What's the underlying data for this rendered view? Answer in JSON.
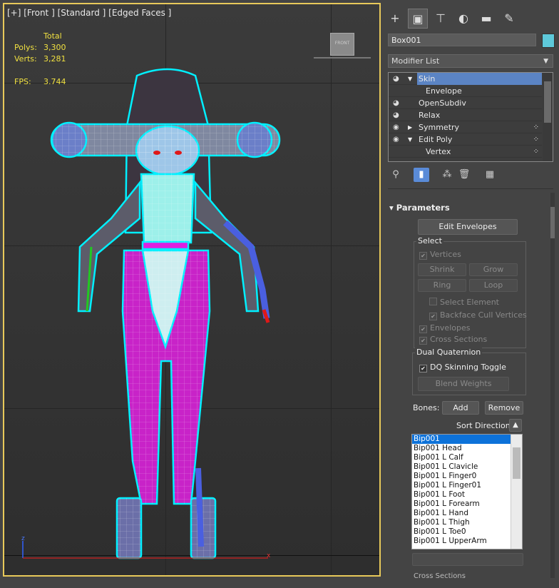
{
  "viewport": {
    "label": "[+] [Front ] [Standard ] [Edged Faces ]",
    "stats": {
      "total_label": "Total",
      "polys_label": "Polys:",
      "polys_value": "3,300",
      "verts_label": "Verts:",
      "verts_value": "3,281",
      "fps_label": "FPS:",
      "fps_value": "3.744"
    },
    "viewcube_label": "FRONT",
    "axis_z": "z",
    "axis_x": "x"
  },
  "command_panel": {
    "tabs": [
      "plus-icon",
      "modify-icon",
      "hierarchy-icon",
      "motion-icon",
      "display-icon",
      "utilities-icon"
    ],
    "object_name": "Box001",
    "object_color": "#5ec9da",
    "modifier_list_label": "Modifier List",
    "stack": [
      {
        "label": "Skin",
        "selected": true
      },
      {
        "label": "Envelope",
        "sub": true
      },
      {
        "label": "OpenSubdiv"
      },
      {
        "label": "Relax"
      },
      {
        "label": "Symmetry"
      },
      {
        "label": "Edit Poly"
      },
      {
        "label": "Vertex",
        "sub": true
      }
    ]
  },
  "parameters": {
    "title": "Parameters",
    "edit_envelopes": "Edit Envelopes",
    "select_group": "Select",
    "vertices": "Vertices",
    "shrink": "Shrink",
    "grow": "Grow",
    "ring": "Ring",
    "loop": "Loop",
    "select_element": "Select Element",
    "backface_cull": "Backface Cull Vertices",
    "envelopes": "Envelopes",
    "cross_sections": "Cross Sections",
    "dq_group": "Dual Quaternion",
    "dq_toggle": "DQ Skinning Toggle",
    "blend_weights": "Blend Weights",
    "bones_label": "Bones:",
    "add": "Add",
    "remove": "Remove",
    "sort_direction": "Sort Direction:",
    "bones": [
      "Bip001",
      "Bip001 Head",
      "Bip001 L Calf",
      "Bip001 L Clavicle",
      "Bip001 L Finger0",
      "Bip001 L Finger01",
      "Bip001 L Foot",
      "Bip001 L Forearm",
      "Bip001 L Hand",
      "Bip001 L Thigh",
      "Bip001 L Toe0",
      "Bip001 L UpperArm"
    ],
    "bottom_hint": "Cross Sections"
  }
}
